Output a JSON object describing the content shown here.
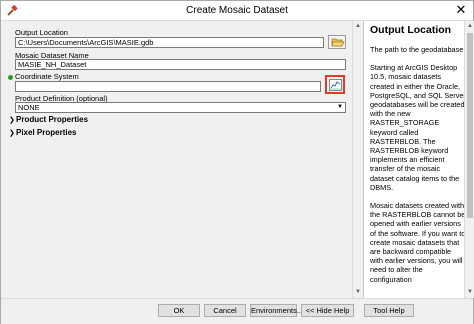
{
  "window": {
    "title": "Create Mosaic Dataset",
    "close_glyph": "✕"
  },
  "form": {
    "output_location": {
      "label": "Output Location",
      "value": "C:\\Users\\Documents\\ArcGIS\\MASIE.gdb"
    },
    "mosaic_dataset_name": {
      "label": "Mosaic Dataset Name",
      "value": "MASIE_NH_Dataset"
    },
    "coordinate_system": {
      "label": "Coordinate System",
      "value": ""
    },
    "product_definition": {
      "label": "Product Definition (optional)",
      "value": "NONE"
    },
    "sections": [
      {
        "label": "Product Properties",
        "expanded": false
      },
      {
        "label": "Pixel Properties",
        "expanded": false
      }
    ]
  },
  "help_panel": {
    "heading": "Output Location",
    "paragraphs": [
      "The path to the geodatabase.",
      "Starting at ArcGIS Desktop 10.5, mosaic datasets created in either the Oracle, PostgreSQL, and SQL Server geodatabases will be created with the new RASTER_STORAGE keyword called RASTERBLOB. The RASTERBLOB keyword implements an efficient transfer of the mosaic dataset catalog items to the DBMS.",
      "Mosaic datasets created with the RASTERBLOB cannot be opened with earlier versions of the software. If you want to create mosaic datasets that are backward compatible with earlier versions, you will need to alter the configuration"
    ]
  },
  "buttons": {
    "ok": "OK",
    "cancel": "Cancel",
    "environments": "Environments...",
    "hide_help": "<< Hide Help",
    "tool_help": "Tool Help"
  },
  "icons": {
    "app": "tool-hammer-icon",
    "browse_folder": "folder-open-icon",
    "spatial_reference": "spatial-reference-icon",
    "required": "required-dot-icon"
  },
  "colors": {
    "highlight_border": "#e03a2a",
    "required_dot": "#2e9b2e"
  }
}
